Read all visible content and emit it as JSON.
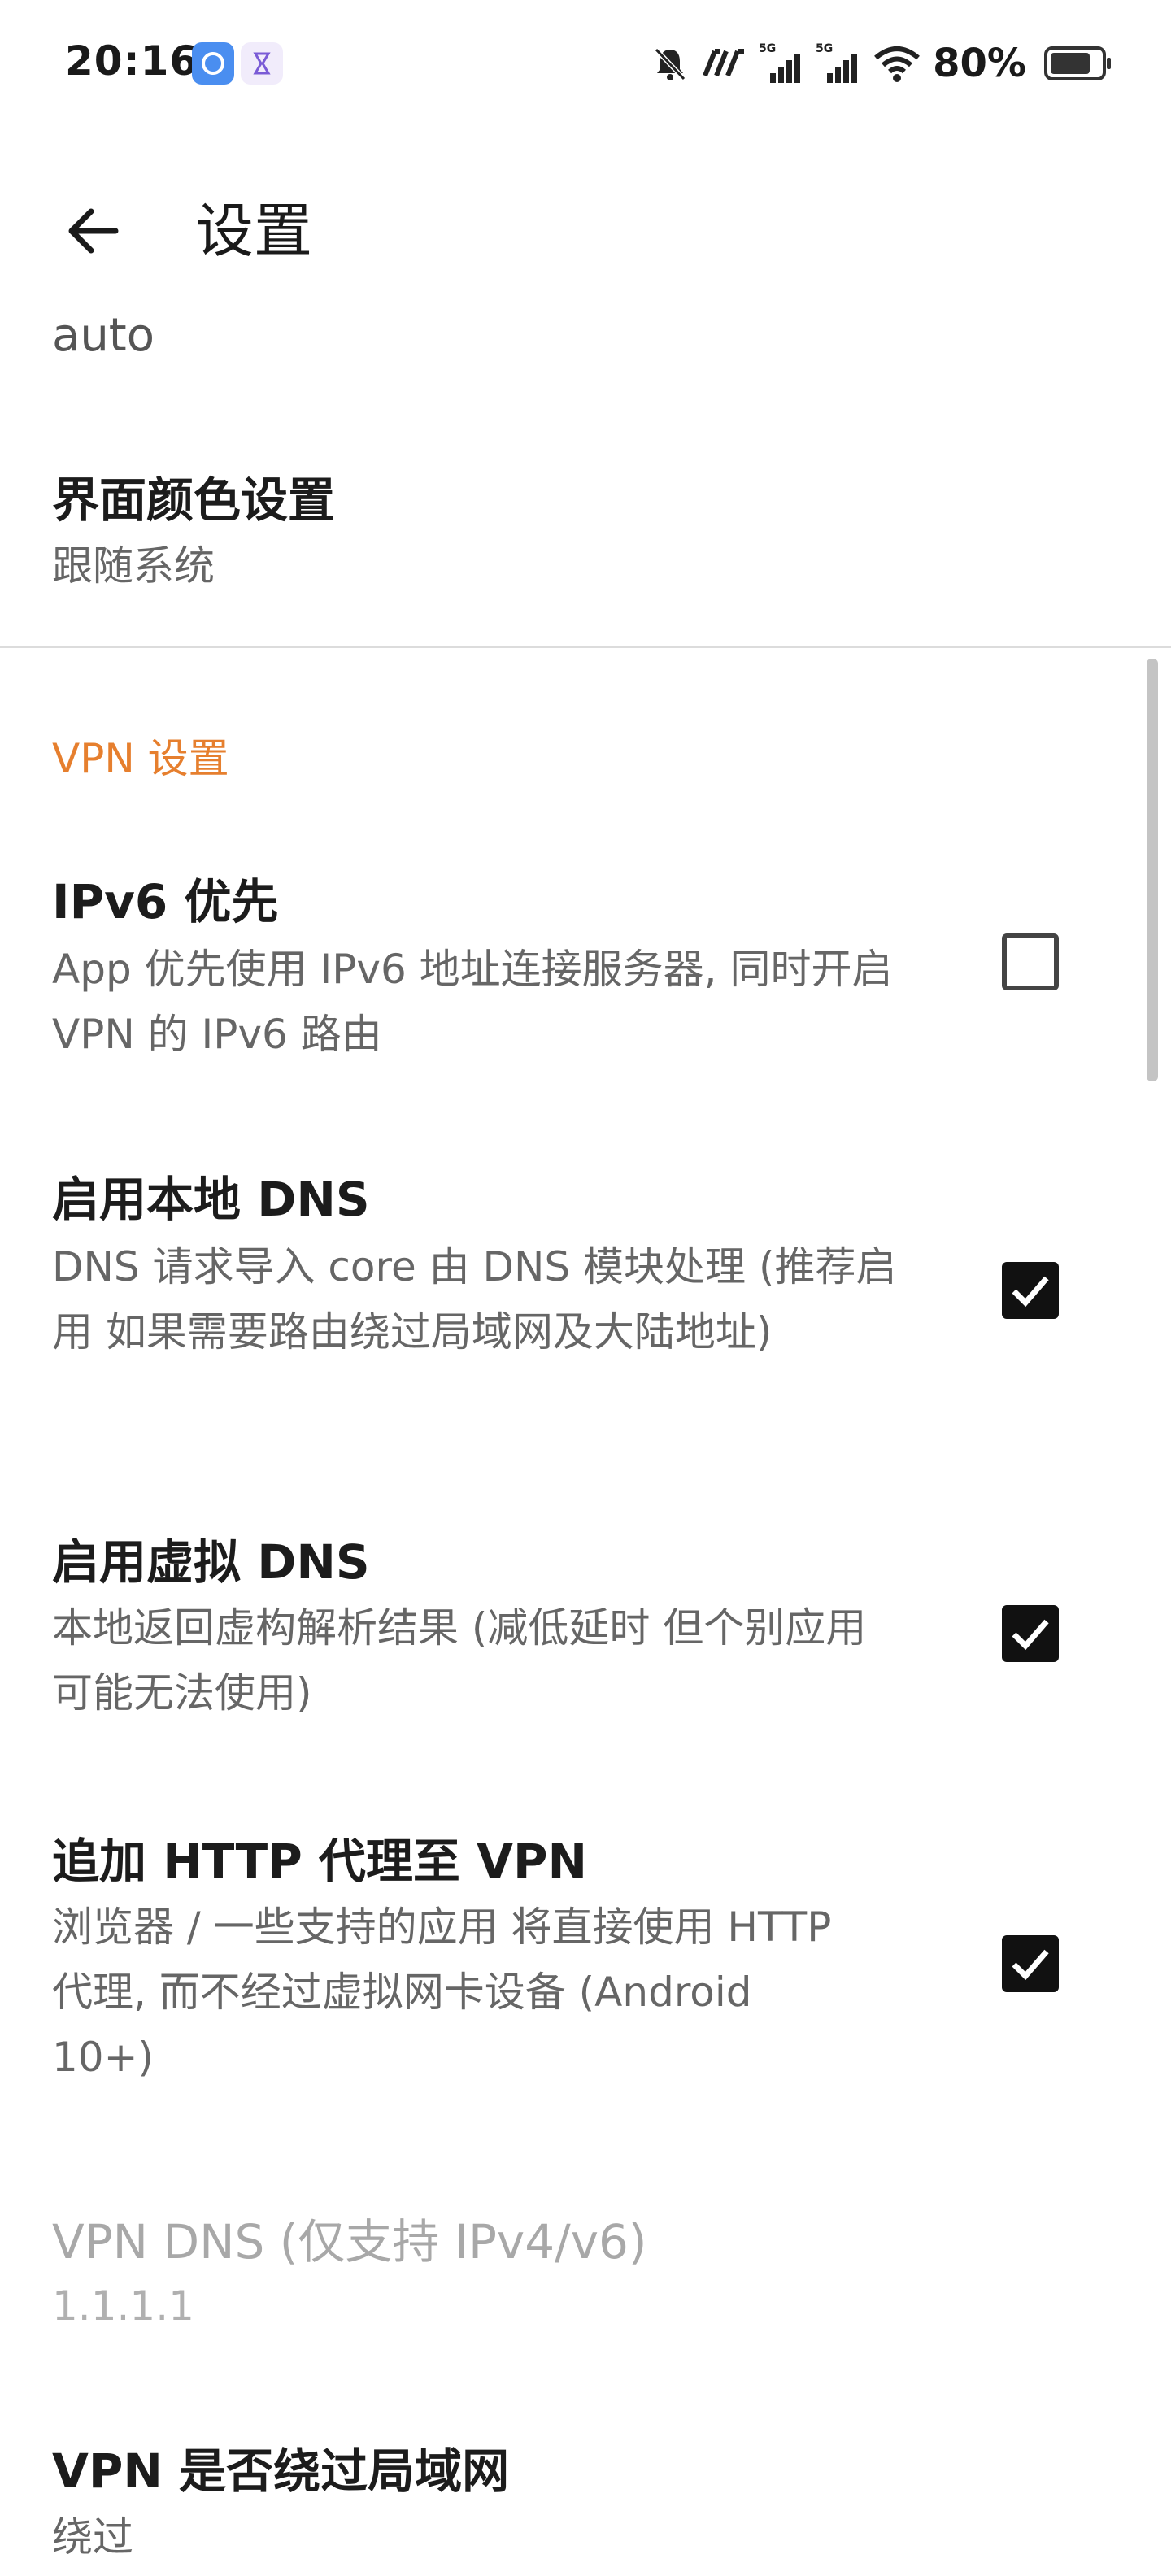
{
  "status_bar": {
    "time": "20:16",
    "battery_text": "80%",
    "battery_level": 0.8,
    "icons": [
      "app-blue-icon",
      "hourglass-icon",
      "mute-bell-icon",
      "nfc-icon",
      "signal-5g-icon",
      "signal-5g-icon",
      "wifi-icon",
      "battery-icon"
    ]
  },
  "header": {
    "title": "设置",
    "back_icon": "arrow-left-icon"
  },
  "settings": {
    "partial_value": "auto",
    "theme": {
      "title": "界面颜色设置",
      "summary": "跟随系统"
    },
    "section_vpn": "VPN 设置",
    "ipv6": {
      "title": "IPv6 优先",
      "summary": "App 优先使用 IPv6 地址连接服务器, 同时开启 VPN 的 IPv6 路由",
      "checked": false
    },
    "local_dns": {
      "title": "启用本地 DNS",
      "summary": "DNS 请求导入 core 由 DNS 模块处理 (推荐启用 如果需要路由绕过局域网及大陆地址)",
      "checked": true
    },
    "fake_dns": {
      "title": "启用虚拟 DNS",
      "summary": "本地返回虚构解析结果 (减低延时 但个别应用可能无法使用)",
      "checked": true
    },
    "http_proxy": {
      "title": "追加 HTTP 代理至 VPN",
      "summary": "浏览器 / 一些支持的应用 将直接使用 HTTP 代理, 而不经过虚拟网卡设备 (Android 10+)",
      "checked": true
    },
    "vpn_dns": {
      "title": "VPN DNS (仅支持 IPv4/v6)",
      "summary": "1.1.1.1",
      "enabled": false
    },
    "bypass_lan": {
      "title": "VPN 是否绕过局域网",
      "summary": "绕过"
    }
  },
  "colors": {
    "accent": "#e67f2e",
    "checkbox": "#111111",
    "divider": "#dcdcdc"
  }
}
